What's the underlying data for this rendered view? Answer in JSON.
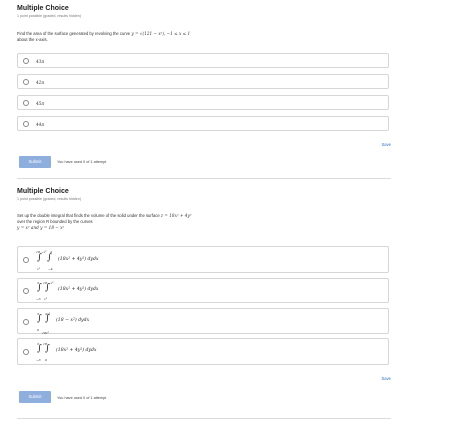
{
  "q1": {
    "title": "Multiple Choice",
    "meta": "1 point possible (graded, results hidden)",
    "prompt_pre": "Find the area of the surface generated by revolving the curve",
    "prompt_math": "y = √(121 − x²), −1 ≤ x ≤ 1",
    "prompt_post": "about the x-axis.",
    "options": [
      "43π",
      "42π",
      "45π",
      "44π"
    ],
    "save": "Save",
    "submit": "Submit",
    "attempts": "You have used 0 of 1 attempt"
  },
  "q2": {
    "title": "Multiple Choice",
    "meta": "1 point possible (graded, results hidden)",
    "prompt_l1_pre": "Set up the double integral that finds the volume of the solid under the surface",
    "prompt_l1_math": "z = 18x² + 4y²",
    "prompt_l2": "over the region R bounded by the curves",
    "prompt_l3_math": "y = x² and y = 18 − x²",
    "options": [
      {
        "upper_outer": "18 −x²",
        "upper_inner": "4",
        "lower_outer": "x²",
        "lower_inner": "−4",
        "integrand": "(18x² + 4y²) dydx"
      },
      {
        "upper_outer": "3",
        "upper_inner": "18 −x²",
        "lower_outer": "−3",
        "lower_inner": "x²",
        "integrand": "(18x² + 4y²) dydx"
      },
      {
        "upper_outer": "3",
        "upper_inner": "4y²",
        "lower_outer": "0",
        "lower_inner": "18x²",
        "integrand": "(18 − x²) dydx"
      },
      {
        "upper_outer": "3",
        "upper_inner": "18",
        "lower_outer": "−3",
        "lower_inner": "0",
        "integrand": "(18x² + 4y²) dydx"
      }
    ],
    "save": "Save",
    "submit": "Submit",
    "attempts": "You have used 0 of 1 attempt"
  }
}
